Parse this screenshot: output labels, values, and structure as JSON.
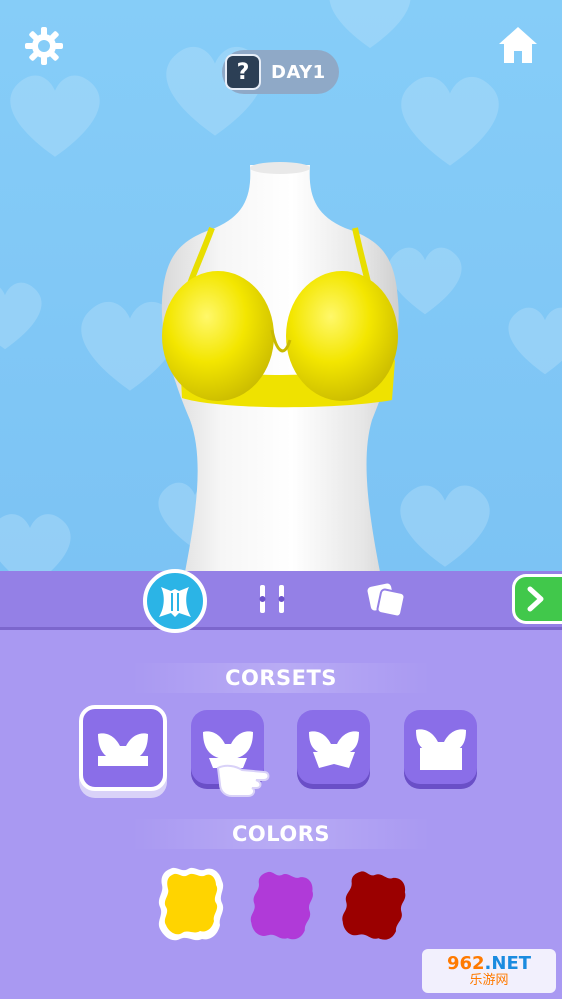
{
  "header": {
    "day_badge_icon": "?",
    "day_label": "DAY1"
  },
  "icons": {
    "settings": "gear-icon",
    "home": "home-icon"
  },
  "tabs": [
    {
      "name": "corset-tab",
      "icon": "corset-icon",
      "active": true
    },
    {
      "name": "straps-tab",
      "icon": "straps-icon",
      "active": false
    },
    {
      "name": "pattern-tab",
      "icon": "pattern-icon",
      "active": false
    }
  ],
  "next_button_icon": "chevron-right-icon",
  "sections": {
    "corsets_title": "CORSETS",
    "colors_title": "COLORS"
  },
  "corsets": [
    {
      "name": "corset-option-1",
      "selected": true
    },
    {
      "name": "corset-option-2",
      "selected": false
    },
    {
      "name": "corset-option-3",
      "selected": false
    },
    {
      "name": "corset-option-4",
      "selected": false
    }
  ],
  "colors": [
    {
      "name": "yellow",
      "hex": "#ffd400",
      "selected": true
    },
    {
      "name": "purple",
      "hex": "#b03ad8",
      "selected": false
    },
    {
      "name": "dark-red",
      "hex": "#9b0000",
      "selected": false
    }
  ],
  "theme": {
    "sky": "#86cdf8",
    "panel": "#a999f2",
    "tabbar": "#9480e6",
    "accent": "#2bb4e6",
    "next": "#41c84b",
    "garment": "#f2e600"
  },
  "watermark": {
    "brand_prefix": "962",
    "brand_suffix": ".NET",
    "subtitle": "乐游网"
  }
}
